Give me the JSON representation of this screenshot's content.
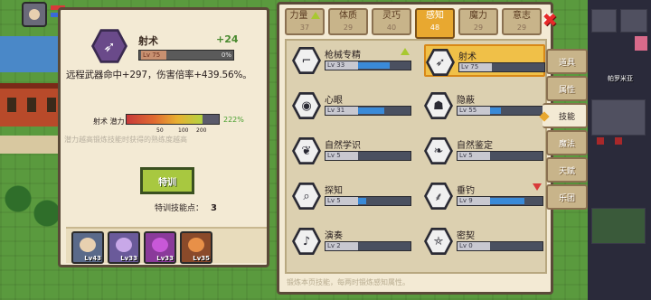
{
  "detail": {
    "skill_name": "射术",
    "gain": "+24",
    "level": "Lv 75",
    "progress": "0%",
    "description": "远程武器命中+297，伤害倍率+439.56%。",
    "potential_label": "射术 潜力",
    "potential_pct": "222%",
    "ticks": [
      "50",
      "100",
      "200"
    ],
    "hint": "潜力越高锻炼技能时获得的熟练度越高"
  },
  "train": {
    "button_label": "特训",
    "points_label": "特训技能点：",
    "points_value": "3"
  },
  "team": [
    {
      "level": "Lv43",
      "color": "#5a6a8a",
      "face": "#e8d0b0"
    },
    {
      "level": "Lv33",
      "color": "#6a5a9a",
      "face": "#c8a8e8"
    },
    {
      "level": "Lv33",
      "color": "#8a3a9a",
      "face": "#c858d8"
    },
    {
      "level": "Lv35",
      "color": "#8a4a2a",
      "face": "#e89048"
    }
  ],
  "attributes": [
    {
      "name": "力量",
      "value": "37",
      "up": true
    },
    {
      "name": "体质",
      "value": "29",
      "up": false
    },
    {
      "name": "灵巧",
      "value": "40",
      "up": false
    },
    {
      "name": "感知",
      "value": "48",
      "up": false,
      "active": true
    },
    {
      "name": "魔力",
      "value": "29",
      "up": false
    },
    {
      "name": "意志",
      "value": "29",
      "up": false
    }
  ],
  "skills": [
    {
      "name": "枪械专精",
      "level": "Lv 33",
      "fill": 0.6,
      "icon": "revolver-icon",
      "glyph": "⌐",
      "mark": "up"
    },
    {
      "name": "射术",
      "level": "Lv 75",
      "fill": 0.0,
      "icon": "arrows-icon",
      "glyph": "➶",
      "selected": true
    },
    {
      "name": "心眼",
      "level": "Lv 31",
      "fill": 0.5,
      "icon": "eye-icon",
      "glyph": "◉"
    },
    {
      "name": "隐蔽",
      "level": "Lv 55",
      "fill": 0.2,
      "icon": "mask-icon",
      "glyph": "☗"
    },
    {
      "name": "自然学识",
      "level": "Lv 5",
      "fill": 0.0,
      "icon": "leaf-icon",
      "glyph": "❦"
    },
    {
      "name": "自然鉴定",
      "level": "Lv 5",
      "fill": 0.0,
      "icon": "leaf-trio-icon",
      "glyph": "❧"
    },
    {
      "name": "探知",
      "level": "Lv 5",
      "fill": 0.15,
      "icon": "magnifier-icon",
      "glyph": "⌕"
    },
    {
      "name": "垂钓",
      "level": "Lv 9",
      "fill": 0.65,
      "icon": "fishing-rod-icon",
      "glyph": "⸙",
      "mark": "down"
    },
    {
      "name": "演奏",
      "level": "Lv 2",
      "fill": 0.0,
      "icon": "music-note-icon",
      "glyph": "♪"
    },
    {
      "name": "密契",
      "level": "Lv 0",
      "fill": 0.0,
      "icon": "pentagram-icon",
      "glyph": "⛤"
    }
  ],
  "footer": "锻炼本页技能，每两时锻炼感知属性。",
  "side_tabs": [
    {
      "label": "道具"
    },
    {
      "label": "属性"
    },
    {
      "label": "技能",
      "active": true
    },
    {
      "label": "魔法"
    },
    {
      "label": "天赋"
    },
    {
      "label": "乐团"
    }
  ],
  "map_label": "帕罗米亚",
  "close_label": "✖"
}
